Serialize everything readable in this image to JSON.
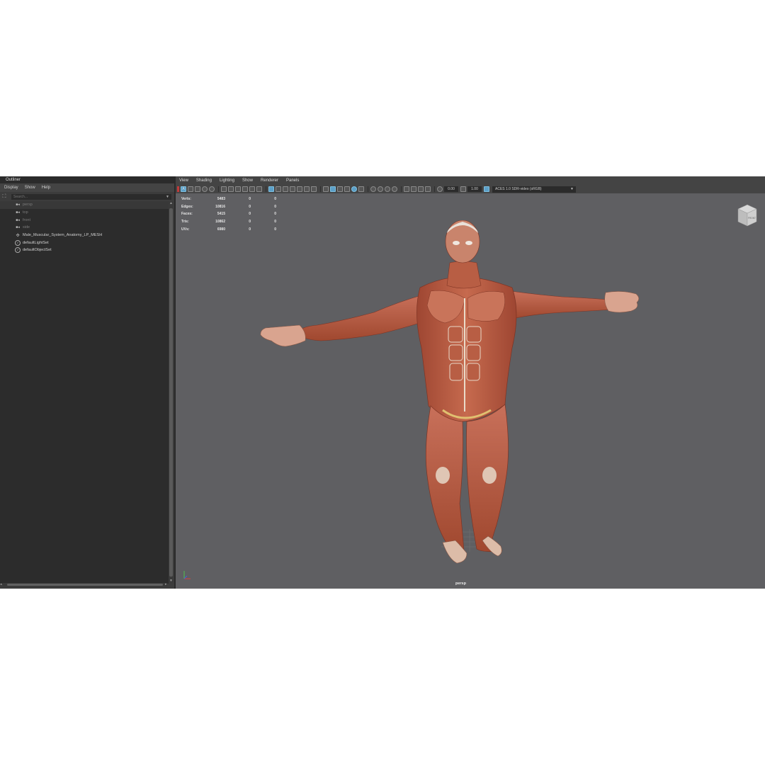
{
  "outliner": {
    "title": "Outliner",
    "menu": [
      "Display",
      "Show",
      "Help"
    ],
    "search_placeholder": "Search...",
    "items": [
      {
        "label": "persp",
        "icon": "camera-icon",
        "dim": true,
        "selected": true
      },
      {
        "label": "top",
        "icon": "camera-icon",
        "dim": true,
        "selected": false
      },
      {
        "label": "front",
        "icon": "camera-icon",
        "dim": true,
        "selected": false
      },
      {
        "label": "side",
        "icon": "camera-icon",
        "dim": true,
        "selected": false
      },
      {
        "label": "Male_Muscular_System_Anatomy_LP_MESH",
        "icon": "mesh-icon",
        "dim": false,
        "selected": false
      },
      {
        "label": "defaultLightSet",
        "icon": "set-icon",
        "dim": false,
        "selected": false
      },
      {
        "label": "defaultObjectSet",
        "icon": "set-icon",
        "dim": false,
        "selected": false
      }
    ]
  },
  "viewport": {
    "menu": [
      "View",
      "Shading",
      "Lighting",
      "Show",
      "Renderer",
      "Panels"
    ],
    "exposure": "0.00",
    "gamma": "1.00",
    "color_space": "ACES 1.0 SDR-video (sRGB)",
    "camera_label": "persp",
    "view_cube_label": "FRONT",
    "hud": [
      {
        "label": "Verts:",
        "v1": "5483",
        "v2": "0",
        "v3": "0"
      },
      {
        "label": "Edges:",
        "v1": "10816",
        "v2": "0",
        "v3": "0"
      },
      {
        "label": "Faces:",
        "v1": "5415",
        "v2": "0",
        "v3": "0"
      },
      {
        "label": "Tris:",
        "v1": "10862",
        "v2": "0",
        "v3": "0"
      },
      {
        "label": "UVs:",
        "v1": "6980",
        "v2": "0",
        "v3": "0"
      }
    ]
  },
  "colors": {
    "viewport_bg": "#5f5f62",
    "panel_bg": "#3c3c3c",
    "accent_blue": "#5ca0c8",
    "muscle": "#b9573f"
  }
}
